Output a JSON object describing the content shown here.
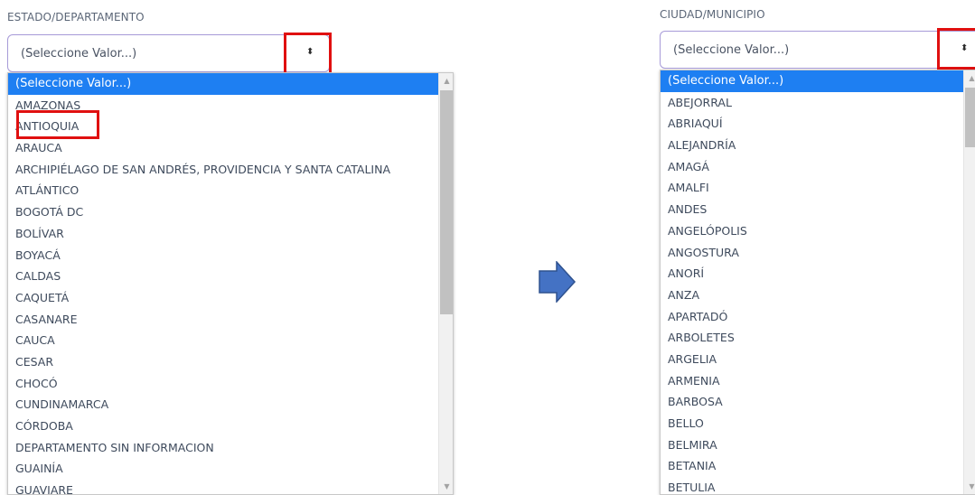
{
  "left": {
    "label": "ESTADO/DEPARTAMENTO",
    "select_value": "(Seleccione Valor...)",
    "options": [
      "(Seleccione Valor...)",
      "AMAZONAS",
      "ANTIOQUIA",
      "ARAUCA",
      "ARCHIPIÉLAGO DE SAN ANDRÉS, PROVIDENCIA Y SANTA CATALINA",
      "ATLÁNTICO",
      "BOGOTÁ DC",
      "BOLÍVAR",
      "BOYACÁ",
      "CALDAS",
      "CAQUETÁ",
      "CASANARE",
      "CAUCA",
      "CESAR",
      "CHOCÓ",
      "CUNDINAMARCA",
      "CÓRDOBA",
      "DEPARTAMENTO SIN INFORMACION",
      "GUAINÍA",
      "GUAVIARE"
    ],
    "selected_index": 0,
    "highlighted_option_index": 2
  },
  "right": {
    "label": "CIUDAD/MUNICIPIO",
    "select_value": "(Seleccione Valor...)",
    "options": [
      "(Seleccione Valor...)",
      "ABEJORRAL",
      "ABRIAQUÍ",
      "ALEJANDRÍA",
      "AMAGÁ",
      "AMALFI",
      "ANDES",
      "ANGELÓPOLIS",
      "ANGOSTURA",
      "ANORÍ",
      "ANZA",
      "APARTADÓ",
      "ARBOLETES",
      "ARGELIA",
      "ARMENIA",
      "BARBOSA",
      "BELLO",
      "BELMIRA",
      "BETANIA",
      "BETULIA"
    ],
    "selected_index": 0
  },
  "icons": {
    "select_arrow": "sort-updown-icon",
    "transition_arrow": "arrow-right-icon",
    "scroll_up": "triangle-up-icon",
    "scroll_down": "triangle-down-icon"
  },
  "colors": {
    "selected_option_bg": "#1e7ff2",
    "annotation_red": "#e01010",
    "select_border": "#a79ad8",
    "arrow_fill": "#4472c4",
    "arrow_stroke": "#2f528f"
  }
}
